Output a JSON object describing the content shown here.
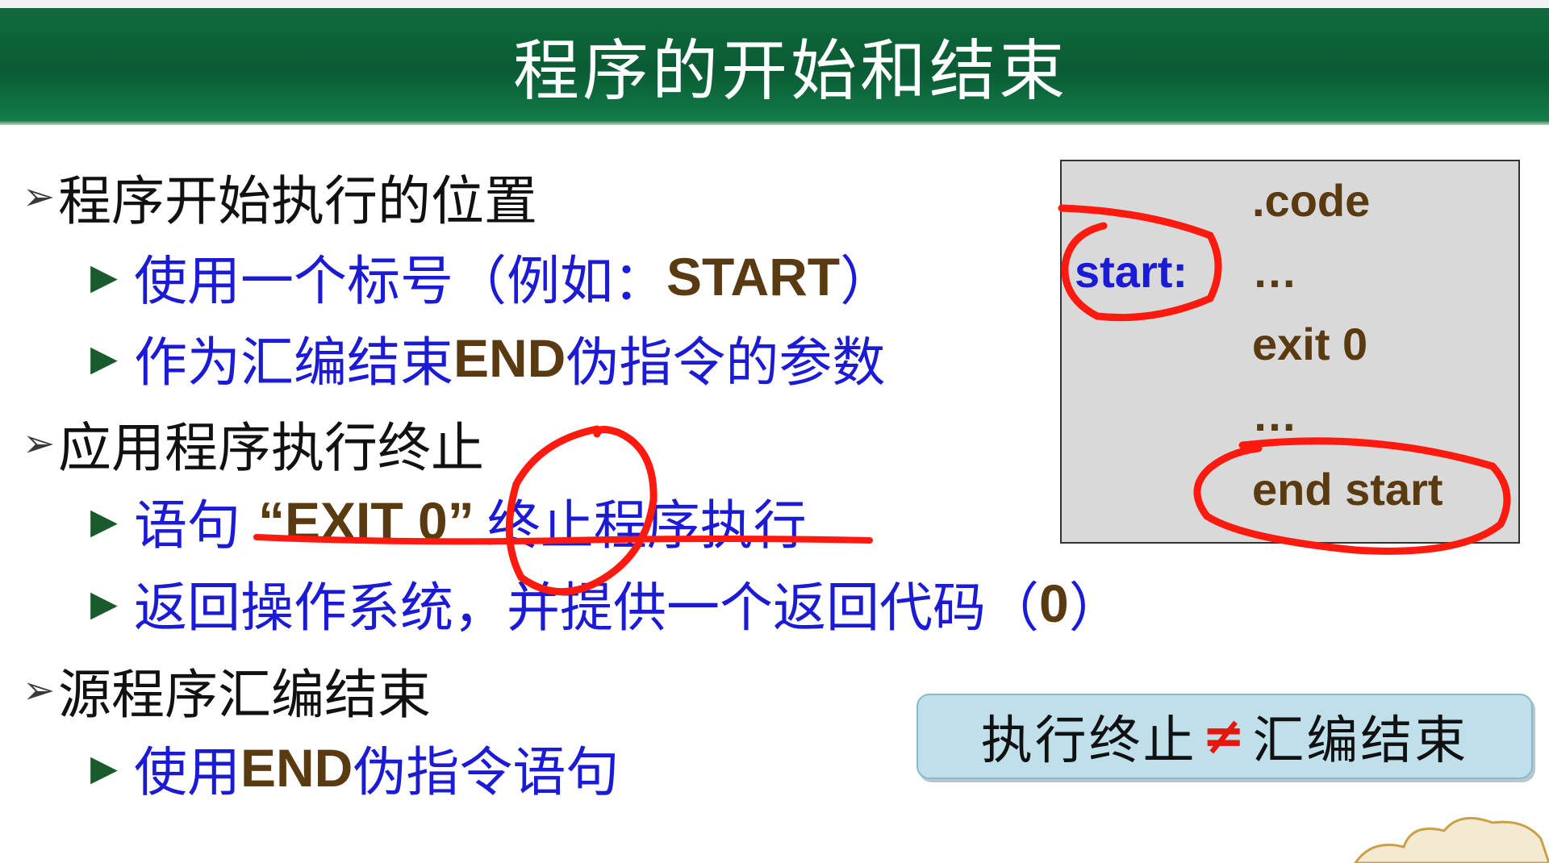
{
  "slide": {
    "title": "程序的开始和结束",
    "sections": [
      {
        "heading": "程序开始执行的位置",
        "items": [
          {
            "pre": "使用一个标号（例如：",
            "code": "START",
            "post": "）"
          },
          {
            "pre": "作为汇编结束",
            "code": "END",
            "post": "伪指令的参数"
          }
        ]
      },
      {
        "heading": "应用程序执行终止",
        "items": [
          {
            "pre": "语句",
            "code": "“EXIT 0”",
            "post": "终止程序执行"
          },
          {
            "pre": "返回操作系统，并提供一个返回代码（",
            "code": "0",
            "post": "）"
          }
        ]
      },
      {
        "heading": "源程序汇编结束",
        "items": [
          {
            "pre": "使用",
            "code": "END",
            "post": "伪指令语句"
          }
        ]
      }
    ],
    "code_box": {
      "line1": ".code",
      "label": "start:",
      "line2": "…",
      "line3": "exit 0",
      "line4": "…",
      "line5": "end start"
    },
    "note": {
      "left": "执行终止",
      "symbol": "≠",
      "right": "汇编结束"
    },
    "colors": {
      "title_bar": "#0a5b33",
      "item_text": "#1b1bd6",
      "code_text": "#5a3a10",
      "annotation": "#e3170a"
    }
  }
}
